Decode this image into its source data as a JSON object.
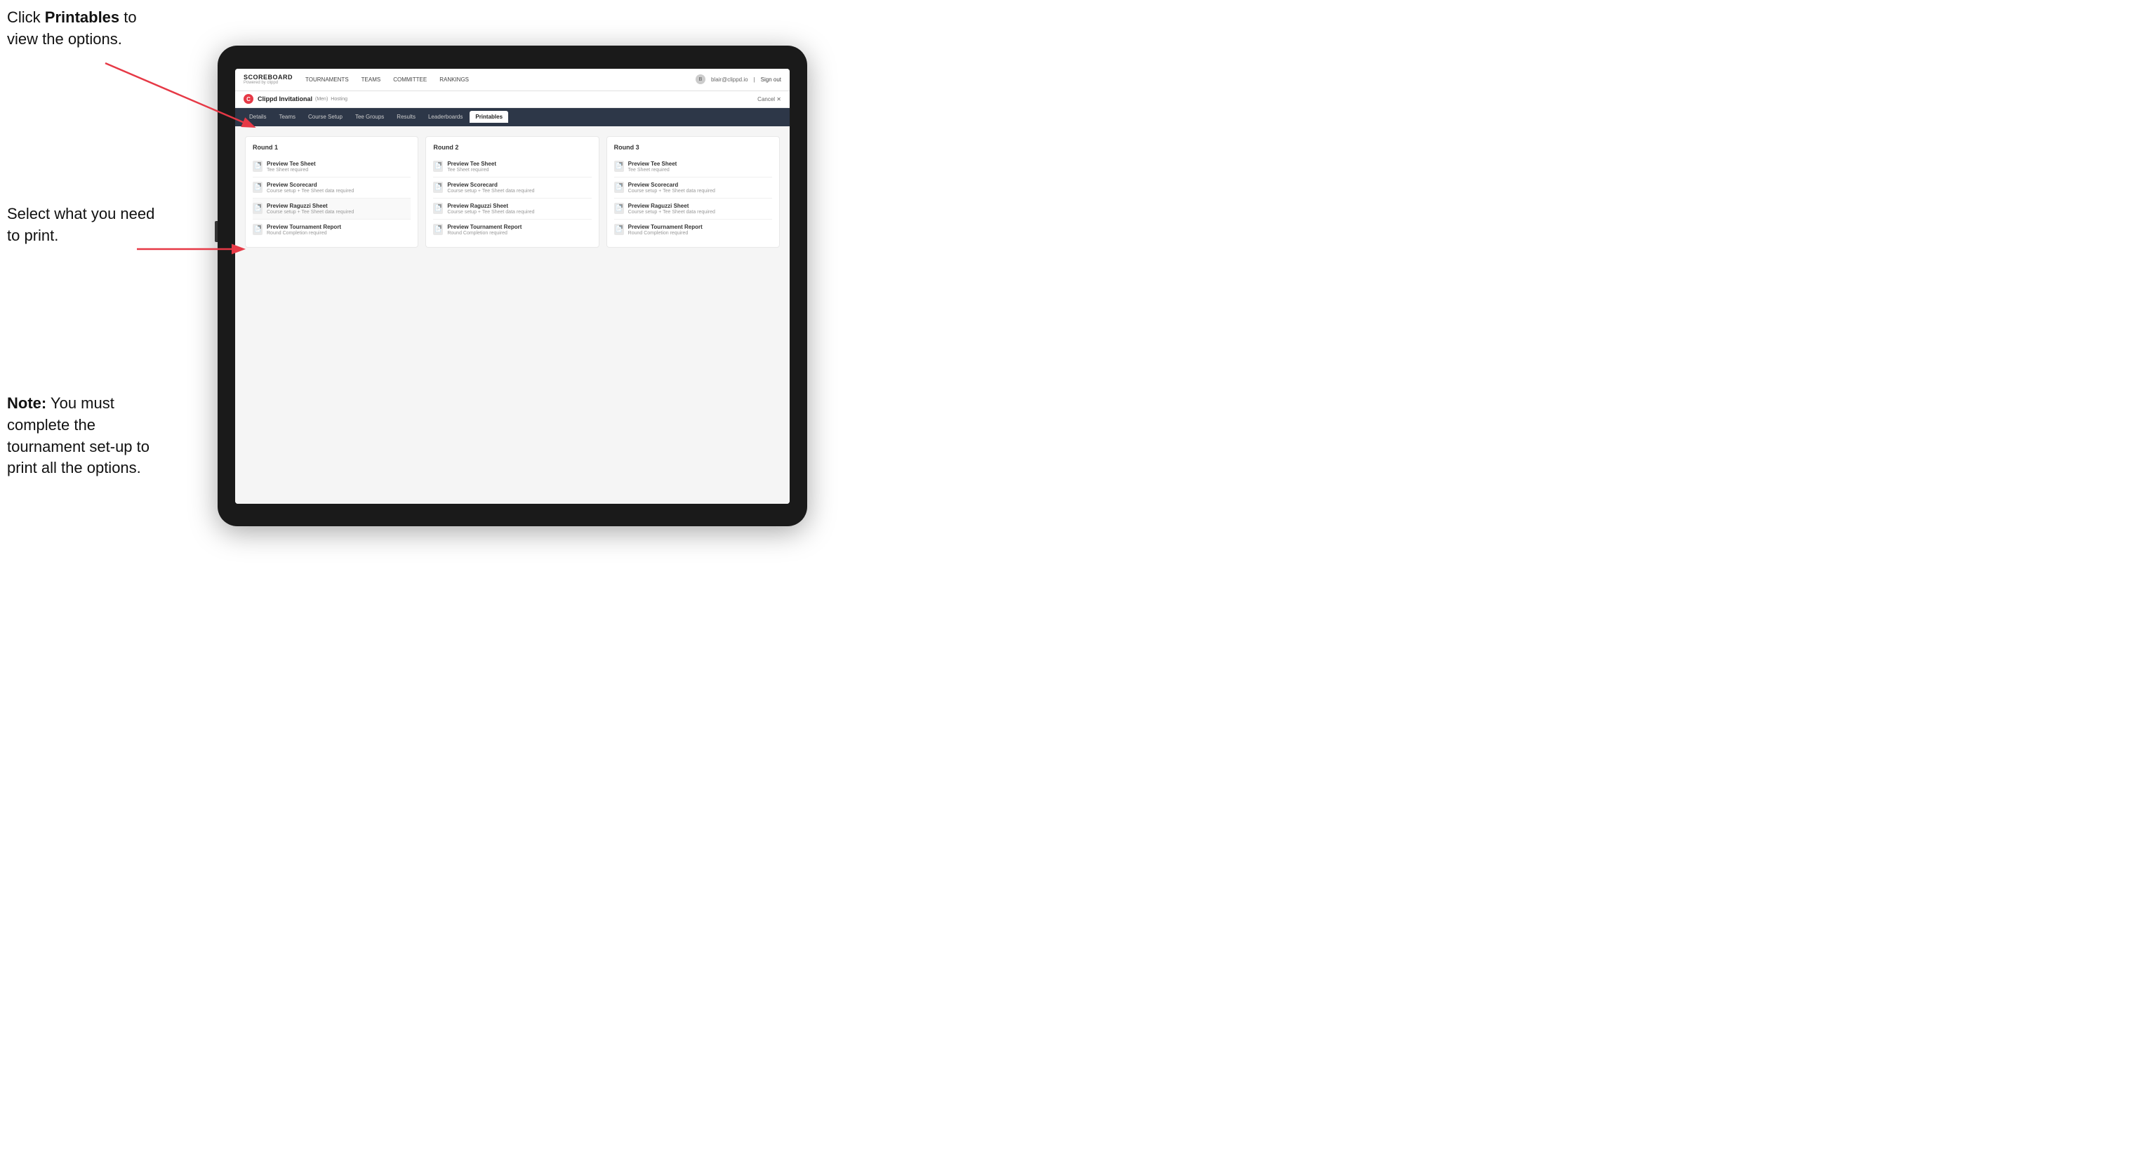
{
  "instructions": {
    "top": "Click ",
    "top_bold": "Printables",
    "top_suffix": " to view the options.",
    "middle": "Select what you need to print.",
    "bottom_bold": "Note:",
    "bottom_suffix": " You must complete the tournament set-up to print all the options."
  },
  "nav": {
    "brand": "SCOREBOARD",
    "brand_sub": "Powered by clippd",
    "links": [
      "TOURNAMENTS",
      "TEAMS",
      "COMMITTEE",
      "RANKINGS"
    ],
    "user_email": "blair@clippd.io",
    "sign_out": "Sign out"
  },
  "tournament": {
    "name": "Clippd Invitational",
    "badge": "(Men)",
    "status": "Hosting",
    "cancel": "Cancel ✕"
  },
  "sub_tabs": [
    "Details",
    "Teams",
    "Course Setup",
    "Tee Groups",
    "Results",
    "Leaderboards",
    "Printables"
  ],
  "active_tab": "Printables",
  "rounds": [
    {
      "title": "Round 1",
      "items": [
        {
          "name": "Preview Tee Sheet",
          "desc": "Tee Sheet required"
        },
        {
          "name": "Preview Scorecard",
          "desc": "Course setup + Tee Sheet data required"
        },
        {
          "name": "Preview Raguzzi Sheet",
          "desc": "Course setup + Tee Sheet data required"
        },
        {
          "name": "Preview Tournament Report",
          "desc": "Round Completion required"
        }
      ]
    },
    {
      "title": "Round 2",
      "items": [
        {
          "name": "Preview Tee Sheet",
          "desc": "Tee Sheet required"
        },
        {
          "name": "Preview Scorecard",
          "desc": "Course setup + Tee Sheet data required"
        },
        {
          "name": "Preview Raguzzi Sheet",
          "desc": "Course setup + Tee Sheet data required"
        },
        {
          "name": "Preview Tournament Report",
          "desc": "Round Completion required"
        }
      ]
    },
    {
      "title": "Round 3",
      "items": [
        {
          "name": "Preview Tee Sheet",
          "desc": "Tee Sheet required"
        },
        {
          "name": "Preview Scorecard",
          "desc": "Course setup + Tee Sheet data required"
        },
        {
          "name": "Preview Raguzzi Sheet",
          "desc": "Course setup + Tee Sheet data required"
        },
        {
          "name": "Preview Tournament Report",
          "desc": "Round Completion required"
        }
      ]
    }
  ],
  "colors": {
    "arrow": "#e63946",
    "active_tab_bg": "#ffffff",
    "nav_bg": "#2d3748"
  }
}
